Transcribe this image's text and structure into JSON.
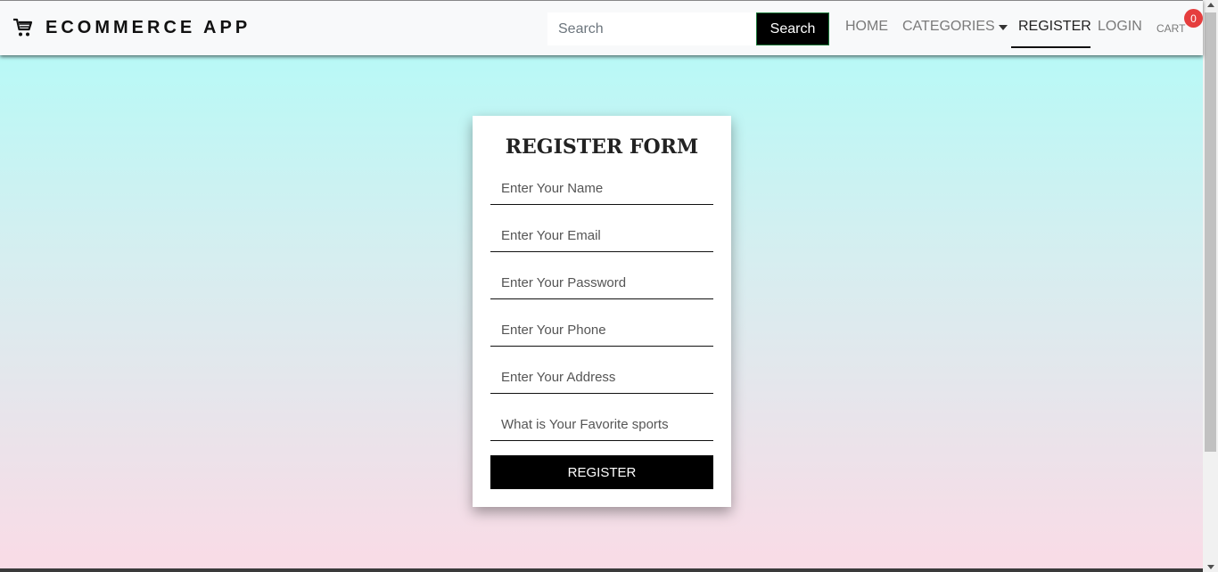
{
  "navbar": {
    "brand_text": "ECOMMERCE APP",
    "brand_icon": "shopping-cart-icon",
    "search_placeholder": "Search",
    "search_button": "Search",
    "links": {
      "home": "HOME",
      "categories": "CATEGORIES",
      "register": "REGISTER",
      "login": "LOGIN",
      "cart": "CART"
    },
    "cart_count": "0",
    "active_link": "register"
  },
  "form": {
    "title": "REGISTER FORM",
    "fields": [
      {
        "placeholder": "Enter Your Name",
        "value": ""
      },
      {
        "placeholder": "Enter Your Email",
        "value": ""
      },
      {
        "placeholder": "Enter Your Password",
        "value": ""
      },
      {
        "placeholder": "Enter Your Phone",
        "value": ""
      },
      {
        "placeholder": "Enter Your Address",
        "value": ""
      },
      {
        "placeholder": "What is Your Favorite sports",
        "value": ""
      }
    ],
    "submit_label": "REGISTER"
  },
  "colors": {
    "background_top": "#b0fcf8",
    "background_bottom": "#fadbe6",
    "button": "#000000",
    "badge": "#e53e3e"
  }
}
